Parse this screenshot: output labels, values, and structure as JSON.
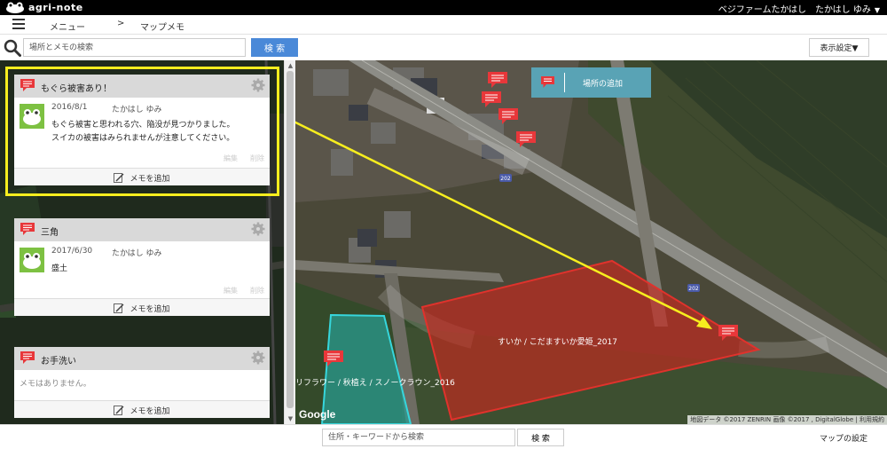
{
  "app": {
    "logo_text": "agri-note",
    "user": "ベジファームたかはし　たかはし ゆみ",
    "user_arrow": "▼"
  },
  "nav": {
    "menu_label": "メニュー",
    "separator": ">",
    "current": "マップメモ"
  },
  "search": {
    "placeholder": "場所とメモの検索",
    "button": "検 索",
    "display_settings": "表示設定▼"
  },
  "cards": [
    {
      "title": "もぐら被害あり！",
      "date": "2016/8/1",
      "author": "たかはし ゆみ",
      "text_lines": [
        "もぐら被害と思われる穴、陥没が見つかりました。",
        "スイカの被害はみられませんが注意してください。"
      ],
      "edit": "編集",
      "delete": "削除",
      "add_memo": "メモを追加"
    },
    {
      "title": "三角",
      "date": "2017/6/30",
      "author": "たかはし ゆみ",
      "text_lines": [
        "盛土"
      ],
      "edit": "編集",
      "delete": "削除",
      "add_memo": "メモを追加"
    },
    {
      "title": "お手洗い",
      "empty_text": "メモはありません。",
      "add_memo": "メモを追加"
    }
  ],
  "map": {
    "add_place": "場所の追加",
    "field_red": "すいか / こだますいか愛姫_2017",
    "field_cyan": "リフラワー / 秋植え / スノークラウン_2016",
    "road_number": "202",
    "google": "Google",
    "attribution": "地図データ ©2017 ZENRIN 画像 ©2017 , DigitalGlobe | 利用規約",
    "colors": {
      "field_red": "#e0322c",
      "field_cyan": "#36d6dc",
      "pin": "#e8373a",
      "highlight": "#f7ee1e"
    }
  },
  "bottom": {
    "address_placeholder": "住所・キーワードから検索",
    "search_button": "検 索",
    "map_settings": "マップの設定"
  },
  "icons": [
    "hamburger-icon",
    "search-icon",
    "memo-icon",
    "gear-icon",
    "frog-avatar-icon",
    "pencil-icon",
    "map-pin-icon"
  ]
}
